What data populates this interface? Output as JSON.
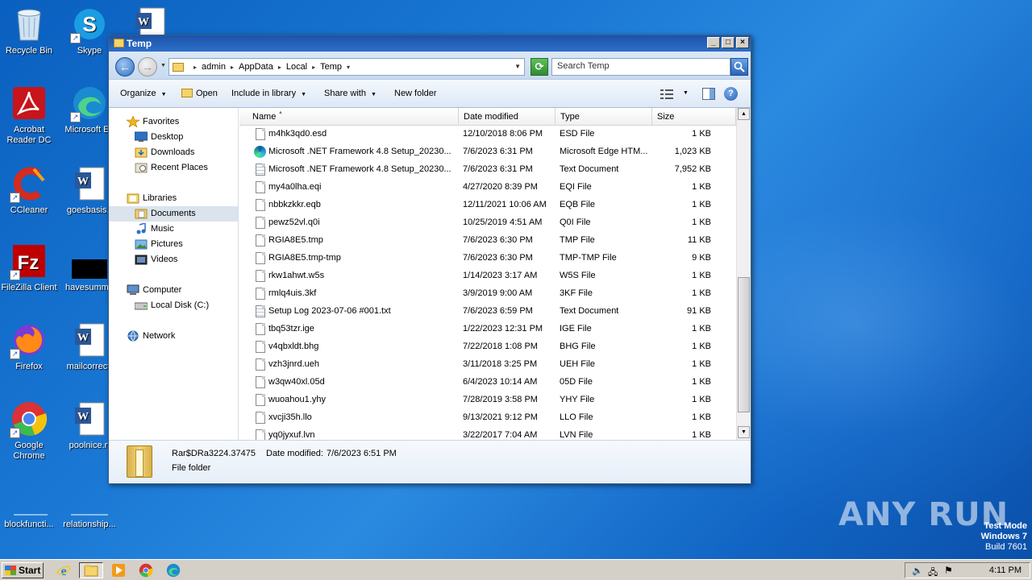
{
  "desktop": {
    "icons": [
      {
        "label": "Recycle Bin",
        "icon": "recycle-bin-icon"
      },
      {
        "label": "Skype",
        "icon": "skype-icon"
      },
      {
        "label": "",
        "icon": "word-doc-icon"
      },
      {
        "label": "Acrobat Reader DC",
        "icon": "acrobat-icon"
      },
      {
        "label": "Microsoft Ed",
        "icon": "edge-icon"
      },
      {
        "label": "CCleaner",
        "icon": "ccleaner-icon"
      },
      {
        "label": "goesbasis.r",
        "icon": "word-doc-icon"
      },
      {
        "label": "FileZilla Client",
        "icon": "filezilla-icon"
      },
      {
        "label": "havesumma",
        "icon": "black-file-icon"
      },
      {
        "label": "Firefox",
        "icon": "firefox-icon"
      },
      {
        "label": "mailcorrect.",
        "icon": "word-doc-icon"
      },
      {
        "label": "Google Chrome",
        "icon": "chrome-icon"
      },
      {
        "label": "poolnice.rt",
        "icon": "word-doc-icon"
      },
      {
        "label": "blockfuncti...",
        "icon": "blank-file-icon"
      },
      {
        "label": "relationship...",
        "icon": "blank-file-icon"
      }
    ]
  },
  "window": {
    "title": "Temp",
    "breadcrumb": [
      "admin",
      "AppData",
      "Local",
      "Temp"
    ],
    "search_placeholder": "Search Temp",
    "toolbar": {
      "organize": "Organize",
      "open": "Open",
      "include": "Include in library",
      "share": "Share with",
      "new_folder": "New folder"
    },
    "nav": {
      "favorites": "Favorites",
      "desktop": "Desktop",
      "downloads": "Downloads",
      "recent": "Recent Places",
      "libraries": "Libraries",
      "documents": "Documents",
      "music": "Music",
      "pictures": "Pictures",
      "videos": "Videos",
      "computer": "Computer",
      "local_disk": "Local Disk (C:)",
      "network": "Network"
    },
    "columns": {
      "name": "Name",
      "date": "Date modified",
      "type": "Type",
      "size": "Size"
    },
    "files": [
      {
        "name": "m4hk3qd0.esd",
        "date": "12/10/2018 8:06 PM",
        "type": "ESD File",
        "size": "1 KB",
        "icon": "file"
      },
      {
        "name": "Microsoft .NET Framework 4.8 Setup_20230...",
        "date": "7/6/2023 6:31 PM",
        "type": "Microsoft Edge HTM...",
        "size": "1,023 KB",
        "icon": "edge"
      },
      {
        "name": "Microsoft .NET Framework 4.8 Setup_20230...",
        "date": "7/6/2023 6:31 PM",
        "type": "Text Document",
        "size": "7,952 KB",
        "icon": "txt"
      },
      {
        "name": "my4a0lha.eqi",
        "date": "4/27/2020 8:39 PM",
        "type": "EQI File",
        "size": "1 KB",
        "icon": "file"
      },
      {
        "name": "nbbkzkkr.eqb",
        "date": "12/11/2021 10:06 AM",
        "type": "EQB File",
        "size": "1 KB",
        "icon": "file"
      },
      {
        "name": "pewz52vl.q0i",
        "date": "10/25/2019 4:51 AM",
        "type": "Q0I File",
        "size": "1 KB",
        "icon": "file"
      },
      {
        "name": "RGIA8E5.tmp",
        "date": "7/6/2023 6:30 PM",
        "type": "TMP File",
        "size": "11 KB",
        "icon": "file"
      },
      {
        "name": "RGIA8E5.tmp-tmp",
        "date": "7/6/2023 6:30 PM",
        "type": "TMP-TMP File",
        "size": "9 KB",
        "icon": "file"
      },
      {
        "name": "rkw1ahwt.w5s",
        "date": "1/14/2023 3:17 AM",
        "type": "W5S File",
        "size": "1 KB",
        "icon": "file"
      },
      {
        "name": "rmlq4uis.3kf",
        "date": "3/9/2019 9:00 AM",
        "type": "3KF File",
        "size": "1 KB",
        "icon": "file"
      },
      {
        "name": "Setup Log 2023-07-06 #001.txt",
        "date": "7/6/2023 6:59 PM",
        "type": "Text Document",
        "size": "91 KB",
        "icon": "txt"
      },
      {
        "name": "tbq53tzr.ige",
        "date": "1/22/2023 12:31 PM",
        "type": "IGE File",
        "size": "1 KB",
        "icon": "file"
      },
      {
        "name": "v4qbxldt.bhg",
        "date": "7/22/2018 1:08 PM",
        "type": "BHG File",
        "size": "1 KB",
        "icon": "file"
      },
      {
        "name": "vzh3jnrd.ueh",
        "date": "3/11/2018 3:25 PM",
        "type": "UEH File",
        "size": "1 KB",
        "icon": "file"
      },
      {
        "name": "w3qw40xl.05d",
        "date": "6/4/2023 10:14 AM",
        "type": "05D File",
        "size": "1 KB",
        "icon": "file"
      },
      {
        "name": "wuoahou1.yhy",
        "date": "7/28/2019 3:58 PM",
        "type": "YHY File",
        "size": "1 KB",
        "icon": "file"
      },
      {
        "name": "xvcji35h.llo",
        "date": "9/13/2021 9:12 PM",
        "type": "LLO File",
        "size": "1 KB",
        "icon": "file"
      },
      {
        "name": "yq0jyxuf.lvn",
        "date": "3/22/2017 7:04 AM",
        "type": "LVN File",
        "size": "1 KB",
        "icon": "file"
      }
    ],
    "details": {
      "name": "Rar$DRa3224.37475",
      "modified_label": "Date modified:",
      "modified_value": "7/6/2023 6:51 PM",
      "type": "File folder"
    }
  },
  "taskbar": {
    "start": "Start",
    "clock": "4:11 PM"
  },
  "watermark": {
    "line1": "Test Mode",
    "line2": "Windows 7",
    "line3": "Build 7601",
    "brand": "ANY RUN"
  }
}
